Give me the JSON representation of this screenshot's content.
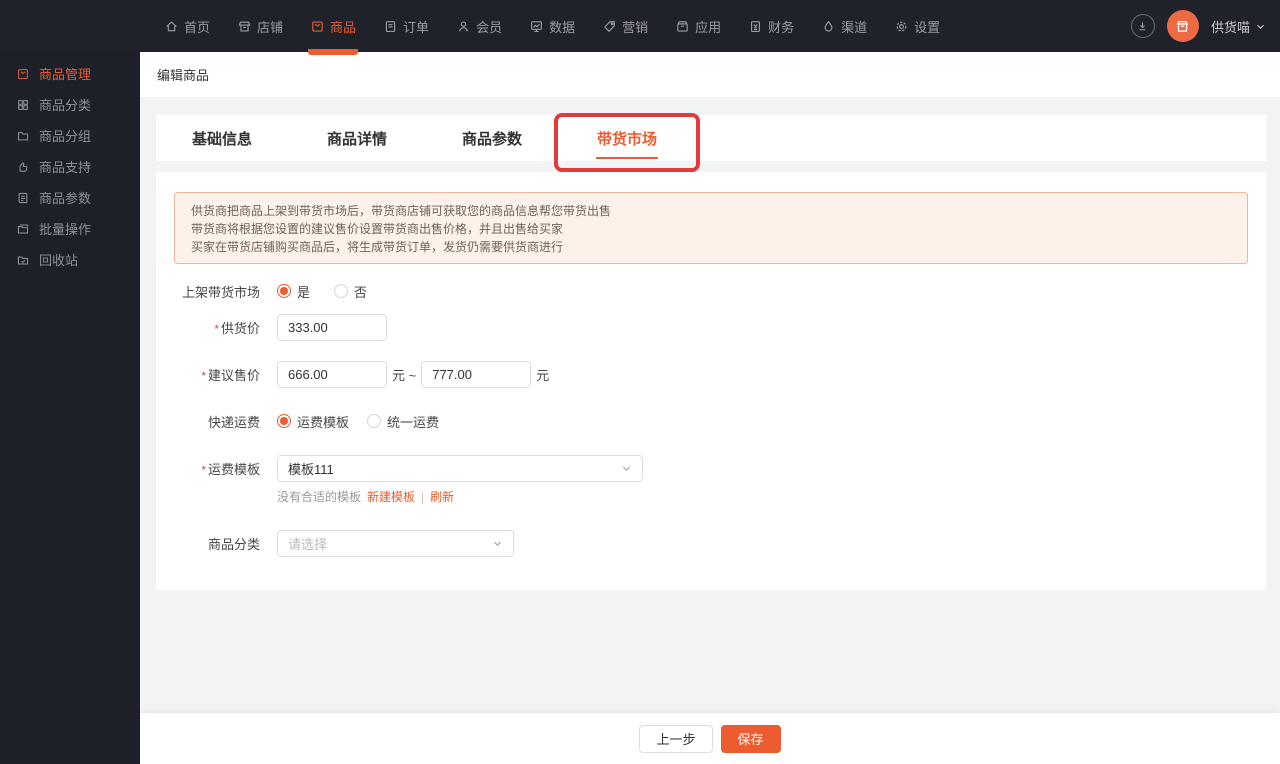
{
  "colors": {
    "accent": "#ed5c2f",
    "annotation_red": "#e23b3b",
    "dark_nav": "#20222b"
  },
  "topnav": {
    "items": [
      {
        "label": "首页"
      },
      {
        "label": "店铺"
      },
      {
        "label": "商品"
      },
      {
        "label": "订单"
      },
      {
        "label": "会员"
      },
      {
        "label": "数据"
      },
      {
        "label": "营销"
      },
      {
        "label": "应用"
      },
      {
        "label": "财务"
      },
      {
        "label": "渠道"
      },
      {
        "label": "设置"
      }
    ],
    "active_label": "商品",
    "user": {
      "name": "供货喵"
    }
  },
  "sidebar": {
    "items": [
      {
        "label": "商品管理"
      },
      {
        "label": "商品分类"
      },
      {
        "label": "商品分组"
      },
      {
        "label": "商品支持"
      },
      {
        "label": "商品参数"
      },
      {
        "label": "批量操作"
      },
      {
        "label": "回收站"
      }
    ],
    "active_label": "商品管理"
  },
  "page": {
    "title": "编辑商品"
  },
  "tabs": {
    "items": [
      {
        "label": "基础信息"
      },
      {
        "label": "商品详情"
      },
      {
        "label": "商品参数"
      },
      {
        "label": "带货市场"
      }
    ],
    "active_label": "带货市场"
  },
  "notice": {
    "lines": [
      "供货商把商品上架到带货市场后，带货商店铺可获取您的商品信息帮您带货出售",
      "带货商将根据您设置的建议售价设置带货商出售价格，并且出售给买家",
      "买家在带货店铺购买商品后，将生成带货订单，发货仍需要供货商进行"
    ]
  },
  "form": {
    "listing": {
      "label": "上架带货市场",
      "option_yes": "是",
      "option_no": "否",
      "selected": "是"
    },
    "supply_price": {
      "label": "供货价",
      "value": "333.00"
    },
    "suggested_price": {
      "label": "建议售价",
      "min": "666.00",
      "max": "777.00",
      "separator": "元 ~",
      "unit": "元"
    },
    "shipping": {
      "label": "快递运费",
      "option_template": "运费模板",
      "option_unified": "统一运费",
      "selected": "运费模板"
    },
    "template": {
      "label": "运费模板",
      "value": "模板111",
      "helper": "没有合适的模板",
      "link_new": "新建模板",
      "link_sep": "|",
      "link_refresh": "刷新"
    },
    "category": {
      "label": "商品分类",
      "placeholder": "请选择"
    }
  },
  "footer": {
    "prev_label": "上一步",
    "save_label": "保存"
  }
}
